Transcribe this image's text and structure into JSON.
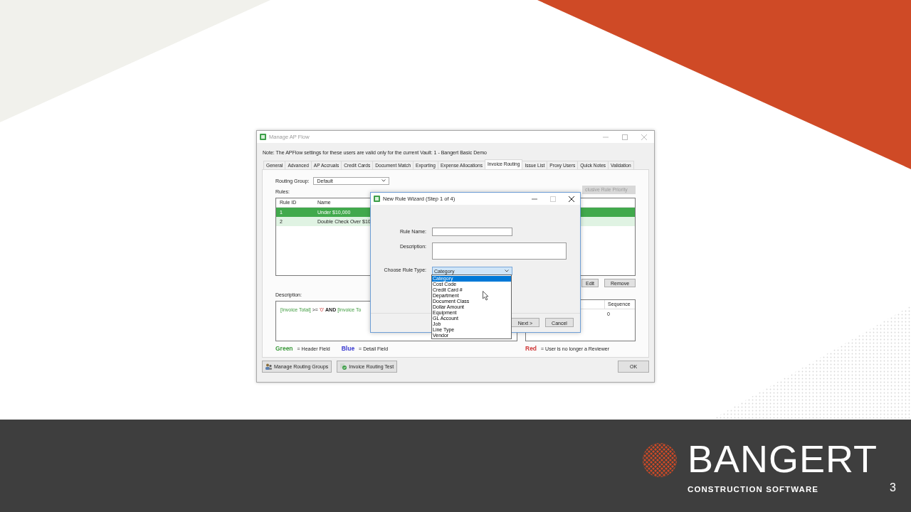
{
  "slide": {
    "brand": "BANGERT",
    "tagline": "CONSTRUCTION SOFTWARE",
    "page_number": "3"
  },
  "window": {
    "title": "Manage AP Flow",
    "note": "Note:  The APFlow settings for these users are valid only for the current Vault: 1 - Bangert Basic Demo",
    "tabs": [
      {
        "label": "General",
        "selected": false
      },
      {
        "label": "Advanced",
        "selected": false
      },
      {
        "label": "AP Accruals",
        "selected": false
      },
      {
        "label": "Credit Cards",
        "selected": false
      },
      {
        "label": "Document Match",
        "selected": false
      },
      {
        "label": "Exporting",
        "selected": false
      },
      {
        "label": "Expense Allocations",
        "selected": false
      },
      {
        "label": "Invoice Routing",
        "selected": true
      },
      {
        "label": "Issue List",
        "selected": false
      },
      {
        "label": "Proxy Users",
        "selected": false
      },
      {
        "label": "Quick Notes",
        "selected": false
      },
      {
        "label": "Validation",
        "selected": false
      }
    ],
    "routing_group": {
      "label": "Routing Group:",
      "value": "Default"
    },
    "rules": {
      "label": "Rules:",
      "columns": [
        "Rule ID",
        "Name"
      ],
      "rows": [
        {
          "cells": [
            "1",
            "Under $10,000"
          ],
          "selected": true
        },
        {
          "cells": [
            "2",
            "Double Check Over $10"
          ],
          "selected": false
        }
      ]
    },
    "priority_button": {
      "label": "clusive Rule Priority",
      "disabled": true
    },
    "rule_buttons": [
      "Edit",
      "Remove"
    ],
    "description": {
      "label": "Description:",
      "parts": [
        {
          "kind": "field",
          "text": "[Invoice Total]"
        },
        {
          "kind": "operator",
          "text": " >= "
        },
        {
          "kind": "value",
          "text": "'0'"
        },
        {
          "kind": "keyword",
          "text": " AND "
        },
        {
          "kind": "field",
          "text": "[Invoice To"
        }
      ]
    },
    "reviewers": {
      "columns": [
        "Sequence"
      ],
      "rows": [
        [
          "0"
        ]
      ]
    },
    "legend": [
      {
        "word": "Green",
        "meaning": "=  Header Field",
        "color": "#3c9a3c"
      },
      {
        "word": "Blue",
        "meaning": "=  Detail Field",
        "color": "#3a3ad0"
      },
      {
        "word": "Red",
        "meaning": "=  User is no longer a Reviewer",
        "color": "#d03a3a"
      }
    ],
    "buttons": [
      {
        "label": "Manage Routing Groups",
        "kind": "groups"
      },
      {
        "label": "Invoice Routing Test",
        "kind": "test"
      },
      {
        "label": "OK",
        "kind": "plain"
      }
    ]
  },
  "dialog": {
    "title": "New Rule Wizard (Step 1 of 4)",
    "fields": [
      {
        "label": "Rule Name:",
        "kind": "text"
      },
      {
        "label": "Description:",
        "kind": "textarea"
      },
      {
        "label": "Choose Rule Type:",
        "kind": "combo",
        "value": "Category"
      }
    ],
    "options": [
      {
        "label": "Category",
        "selected": true
      },
      {
        "label": "Cost Code",
        "selected": false
      },
      {
        "label": "Credit Card #",
        "selected": false
      },
      {
        "label": "Department",
        "selected": false
      },
      {
        "label": "Document Class",
        "selected": false
      },
      {
        "label": "Dollar Amount",
        "selected": false
      },
      {
        "label": "Equipment",
        "selected": false
      },
      {
        "label": "GL Account",
        "selected": false
      },
      {
        "label": "Job",
        "selected": false
      },
      {
        "label": "Line Type",
        "selected": false
      },
      {
        "label": "Vendor",
        "selected": false
      }
    ],
    "buttons": [
      "Next >",
      "Cancel"
    ]
  }
}
